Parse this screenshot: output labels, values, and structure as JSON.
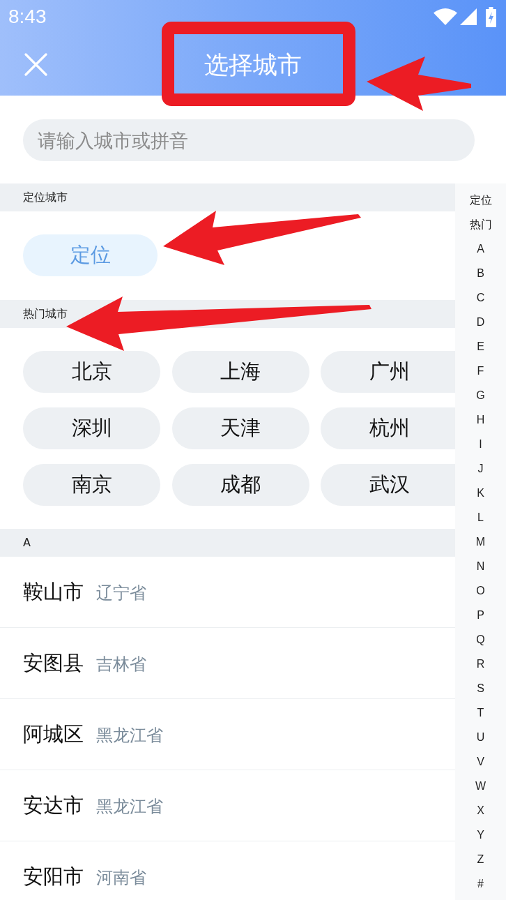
{
  "status_bar": {
    "time": "8:43"
  },
  "header": {
    "title": "选择城市"
  },
  "search": {
    "placeholder": "请输入城市或拼音"
  },
  "location_section": {
    "heading": "定位城市",
    "button": "定位"
  },
  "hot_section": {
    "heading": "热门城市",
    "cities": [
      "北京",
      "上海",
      "广州",
      "深圳",
      "天津",
      "杭州",
      "南京",
      "成都",
      "武汉"
    ]
  },
  "city_groups": [
    {
      "letter": "A",
      "cities": [
        {
          "name": "鞍山市",
          "province": "辽宁省"
        },
        {
          "name": "安图县",
          "province": "吉林省"
        },
        {
          "name": "阿城区",
          "province": "黑龙江省"
        },
        {
          "name": "安达市",
          "province": "黑龙江省"
        },
        {
          "name": "安阳市",
          "province": "河南省"
        }
      ]
    }
  ],
  "index_bar": {
    "items": [
      "定位",
      "热门",
      "A",
      "B",
      "C",
      "D",
      "E",
      "F",
      "G",
      "H",
      "I",
      "J",
      "K",
      "L",
      "M",
      "N",
      "O",
      "P",
      "Q",
      "R",
      "S",
      "T",
      "U",
      "V",
      "W",
      "X",
      "Y",
      "Z",
      "#"
    ]
  }
}
